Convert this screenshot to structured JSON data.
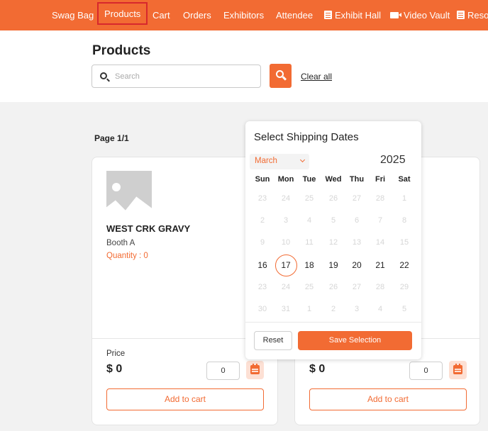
{
  "nav": {
    "items": [
      {
        "label": "Swag Bag",
        "icon": ""
      },
      {
        "label": "Products",
        "icon": "",
        "active": true
      },
      {
        "label": "Cart",
        "icon": ""
      },
      {
        "label": "Orders",
        "icon": ""
      },
      {
        "label": "Exhibitors",
        "icon": ""
      },
      {
        "label": "Attendee",
        "icon": ""
      },
      {
        "label": "Exhibit Hall",
        "icon": "document-icon"
      },
      {
        "label": "Video Vault",
        "icon": "video-camera-icon"
      },
      {
        "label": "Resou",
        "icon": "document-icon"
      }
    ]
  },
  "page": {
    "title": "Products",
    "search_placeholder": "Search",
    "search_value": "",
    "clear_all": "Clear all",
    "page_info": "Page 1/1"
  },
  "products": [
    {
      "name": "WEST CRK GRAVY",
      "booth": "Booth A",
      "quantity": "Quantity : 0",
      "price_label": "Price",
      "price": "$ 0",
      "qty_value": "0",
      "add_label": "Add to cart"
    },
    {
      "name": "",
      "booth": "",
      "quantity": "",
      "price_label": "",
      "price": "$ 0",
      "qty_value": "0",
      "add_label": "Add to cart"
    }
  ],
  "date_picker": {
    "title": "Select Shipping Dates",
    "month": "March",
    "year": "2025",
    "weekdays": [
      "Sun",
      "Mon",
      "Tue",
      "Wed",
      "Thu",
      "Fri",
      "Sat"
    ],
    "weeks": [
      [
        "23",
        "24",
        "25",
        "26",
        "27",
        "28",
        "1"
      ],
      [
        "2",
        "3",
        "4",
        "5",
        "6",
        "7",
        "8"
      ],
      [
        "9",
        "10",
        "11",
        "12",
        "13",
        "14",
        "15"
      ],
      [
        "16",
        "17",
        "18",
        "19",
        "20",
        "21",
        "22"
      ],
      [
        "23",
        "24",
        "25",
        "26",
        "27",
        "28",
        "29"
      ],
      [
        "30",
        "31",
        "1",
        "2",
        "3",
        "4",
        "5"
      ]
    ],
    "enabled_days": [
      "17",
      "18",
      "19",
      "20",
      "21",
      "22"
    ],
    "enabled_week": 3,
    "selected_day": "17",
    "reset_label": "Reset",
    "save_label": "Save Selection"
  },
  "colors": {
    "accent": "#f26b33",
    "active_nav_border": "#d7282d"
  }
}
